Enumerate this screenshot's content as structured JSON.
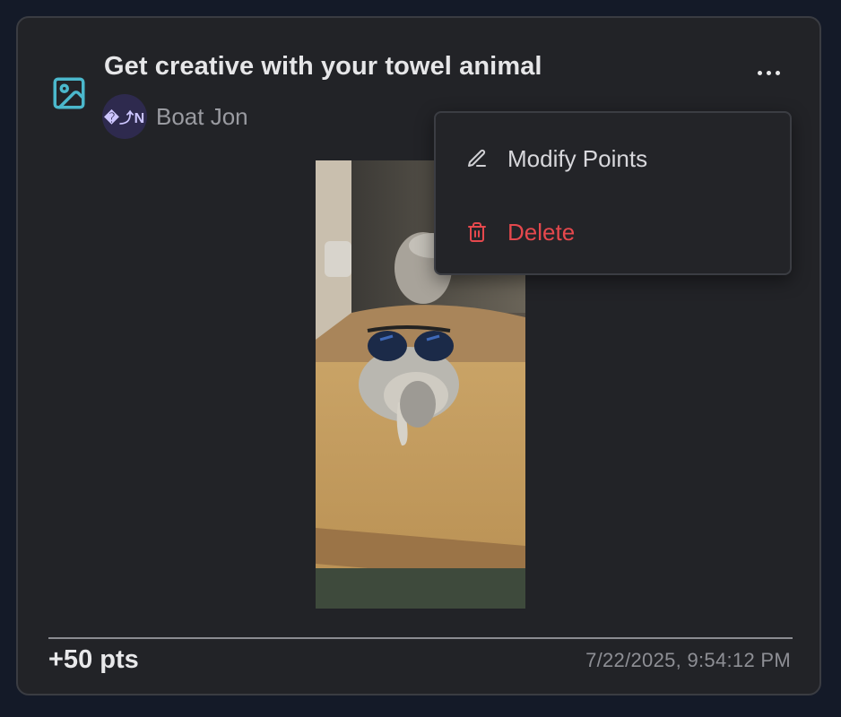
{
  "post": {
    "icon": "image-icon",
    "title": "Get creative with your towel animal",
    "author": {
      "avatar_text": "�⤴N",
      "name": "Boat Jon"
    },
    "more_icon": "more-horizontal-icon",
    "photo": {
      "subject": "towel-animal-photo"
    },
    "points": "+50 pts",
    "timestamp": "7/22/2025, 9:54:12 PM"
  },
  "menu": {
    "items": [
      {
        "label": "Modify Points",
        "icon": "pencil-icon",
        "color": "#d8d8dc"
      },
      {
        "label": "Delete",
        "icon": "trash-icon",
        "color": "#e5484d"
      }
    ]
  },
  "colors": {
    "background": "#141a28",
    "card": "#222327",
    "accent_icon": "#4bb8cc",
    "danger": "#e5484d"
  }
}
